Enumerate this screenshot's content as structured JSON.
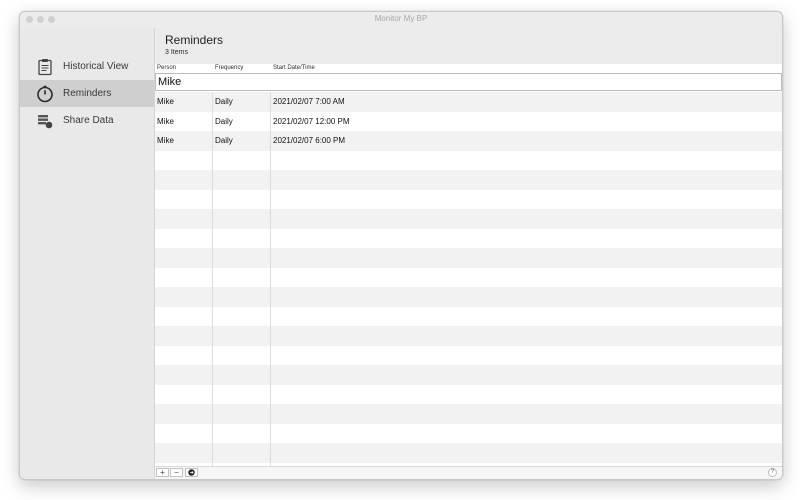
{
  "window": {
    "title": "Monitor My BP"
  },
  "sidebar": {
    "items": [
      {
        "label": "Historical View",
        "icon": "clipboard-icon",
        "selected": false
      },
      {
        "label": "Reminders",
        "icon": "stopwatch-icon",
        "selected": true
      },
      {
        "label": "Share Data",
        "icon": "share-data-icon",
        "selected": false
      }
    ]
  },
  "header": {
    "title": "Reminders",
    "subtitle": "3 Items"
  },
  "table": {
    "columns": [
      "Person",
      "Frequency",
      "Start Date/Time"
    ],
    "group": "Mike",
    "rows": [
      {
        "person": "Mike",
        "frequency": "Daily",
        "start": "2021/02/07 7:00 AM"
      },
      {
        "person": "Mike",
        "frequency": "Daily",
        "start": "2021/02/07 12:00 PM"
      },
      {
        "person": "Mike",
        "frequency": "Daily",
        "start": "2021/02/07 6:00 PM"
      }
    ]
  },
  "footer": {
    "add_label": "+",
    "remove_label": "−",
    "help_label": "?"
  }
}
